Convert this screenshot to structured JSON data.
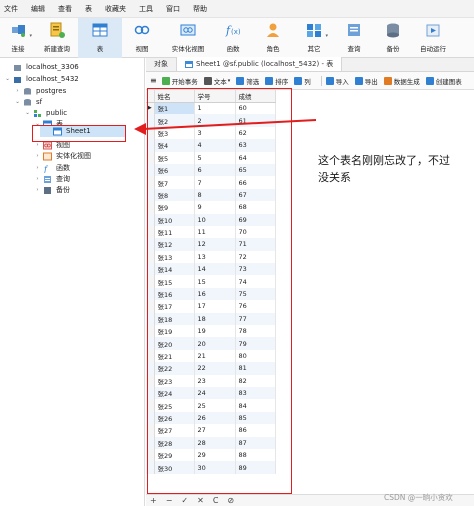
{
  "menu": [
    "文件",
    "编辑",
    "查看",
    "表",
    "收藏夹",
    "工具",
    "窗口",
    "帮助"
  ],
  "toolbar": [
    {
      "label": "连接",
      "icon": "connection-icon",
      "dropdown": true
    },
    {
      "label": "新建查询",
      "icon": "new-query-icon"
    },
    {
      "label": "表",
      "icon": "table-icon",
      "active": true
    },
    {
      "label": "视图",
      "icon": "view-icon"
    },
    {
      "label": "实体化视图",
      "icon": "materialized-view-icon"
    },
    {
      "label": "函数",
      "icon": "function-icon"
    },
    {
      "label": "角色",
      "icon": "role-icon"
    },
    {
      "label": "其它",
      "icon": "other-icon",
      "dropdown": true
    },
    {
      "label": "查询",
      "icon": "query-icon"
    },
    {
      "label": "备份",
      "icon": "backup-icon"
    },
    {
      "label": "自动运行",
      "icon": "automation-icon"
    }
  ],
  "tree": {
    "items": [
      {
        "label": "localhost_3306",
        "level": 0,
        "icon": "mysql-connection-icon"
      },
      {
        "label": "localhost_5432",
        "level": 0,
        "icon": "postgres-connection-icon",
        "expanded": true
      },
      {
        "label": "postgres",
        "level": 1,
        "icon": "database-icon"
      },
      {
        "label": "sf",
        "level": 1,
        "icon": "database-icon",
        "expanded": true
      },
      {
        "label": "public",
        "level": 2,
        "icon": "schema-icon",
        "expanded": true
      },
      {
        "label": "表",
        "level": 3,
        "icon": "tables-folder-icon",
        "expanded": true
      },
      {
        "label": "Sheet1",
        "level": 4,
        "icon": "table-icon",
        "selected": true
      },
      {
        "label": "视图",
        "level": 3,
        "icon": "views-folder-icon"
      },
      {
        "label": "实体化视图",
        "level": 3,
        "icon": "materialized-views-folder-icon"
      },
      {
        "label": "函数",
        "level": 3,
        "icon": "functions-folder-icon"
      },
      {
        "label": "查询",
        "level": 3,
        "icon": "queries-folder-icon"
      },
      {
        "label": "备份",
        "level": 3,
        "icon": "backups-folder-icon"
      }
    ]
  },
  "tabs": {
    "objects_label": "对象",
    "active_tab": "Sheet1 @sf.public (localhost_5432) - 表"
  },
  "actions": [
    {
      "label": "开始事务",
      "icon": "transaction-icon"
    },
    {
      "label": "文本",
      "icon": "text-icon",
      "dropdown": true
    },
    {
      "label": "筛选",
      "icon": "filter-icon"
    },
    {
      "label": "排序",
      "icon": "sort-icon"
    },
    {
      "label": "列",
      "icon": "columns-icon"
    },
    {
      "label": "导入",
      "icon": "import-icon"
    },
    {
      "label": "导出",
      "icon": "export-icon"
    },
    {
      "label": "数据生成",
      "icon": "data-generation-icon"
    },
    {
      "label": "创建图表",
      "icon": "create-chart-icon"
    }
  ],
  "grid": {
    "columns": [
      "姓名",
      "学号",
      "成绩"
    ],
    "rows": [
      [
        "张1",
        "1",
        "60"
      ],
      [
        "张2",
        "2",
        "61"
      ],
      [
        "张3",
        "3",
        "62"
      ],
      [
        "张4",
        "4",
        "63"
      ],
      [
        "张5",
        "5",
        "64"
      ],
      [
        "张6",
        "6",
        "65"
      ],
      [
        "张7",
        "7",
        "66"
      ],
      [
        "张8",
        "8",
        "67"
      ],
      [
        "张9",
        "9",
        "68"
      ],
      [
        "张10",
        "10",
        "69"
      ],
      [
        "张11",
        "11",
        "70"
      ],
      [
        "张12",
        "12",
        "71"
      ],
      [
        "张13",
        "13",
        "72"
      ],
      [
        "张14",
        "14",
        "73"
      ],
      [
        "张15",
        "15",
        "74"
      ],
      [
        "张16",
        "16",
        "75"
      ],
      [
        "张17",
        "17",
        "76"
      ],
      [
        "张18",
        "18",
        "77"
      ],
      [
        "张19",
        "19",
        "78"
      ],
      [
        "张20",
        "20",
        "79"
      ],
      [
        "张21",
        "21",
        "80"
      ],
      [
        "张22",
        "22",
        "81"
      ],
      [
        "张23",
        "23",
        "82"
      ],
      [
        "张24",
        "24",
        "83"
      ],
      [
        "张25",
        "25",
        "84"
      ],
      [
        "张26",
        "26",
        "85"
      ],
      [
        "张27",
        "27",
        "86"
      ],
      [
        "张28",
        "28",
        "87"
      ],
      [
        "张29",
        "29",
        "88"
      ],
      [
        "张30",
        "30",
        "89"
      ]
    ]
  },
  "bottom": [
    "+",
    "−",
    "✓",
    "✕",
    "C",
    "⊘"
  ],
  "annotation": {
    "line1": "这个表名刚刚忘改了，不过",
    "line2": "没关系"
  },
  "watermark": "CSDN @一晌小贪欢",
  "colors": {
    "accent": "#e11d1d",
    "selection": "#cde3f7",
    "row_alt": "#f1f6fc"
  }
}
